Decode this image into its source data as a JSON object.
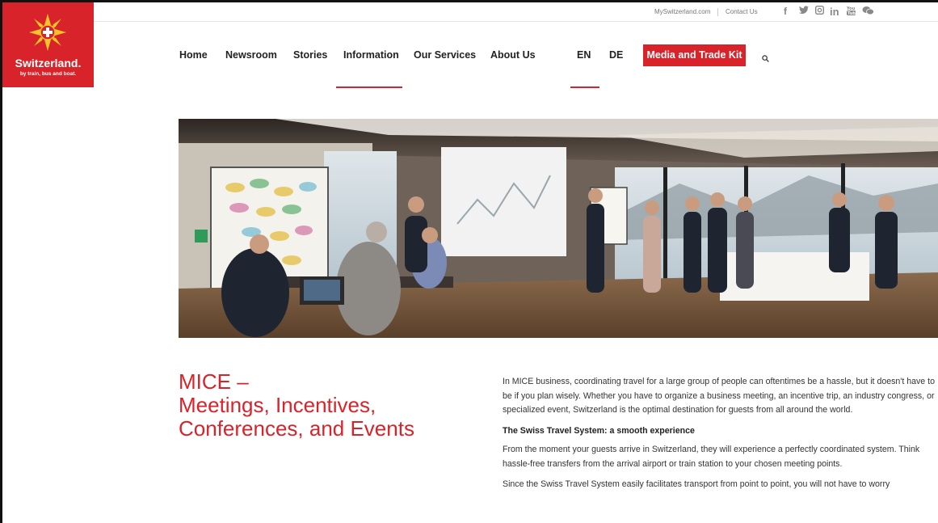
{
  "utility": {
    "myswitzerland": "MySwitzerland.com",
    "contact": "Contact Us"
  },
  "social_icons": [
    "facebook-icon",
    "twitter-icon",
    "instagram-icon",
    "linkedin-icon",
    "youtube-icon",
    "wechat-icon"
  ],
  "logo": {
    "title": "Switzerland.",
    "subtitle": "by train, bus and boat."
  },
  "nav": {
    "items": [
      "Home",
      "Newsroom",
      "Stories",
      "Information",
      "Our Services",
      "About Us"
    ],
    "active": "Information",
    "languages": [
      "EN",
      "DE"
    ],
    "active_language": "EN",
    "cta": "Media and Trade Kit"
  },
  "colors": {
    "brand_red": "#d8232a"
  },
  "main": {
    "heading_lines": [
      "MICE –",
      "Meetings, Incentives,",
      "Conferences, and Events"
    ],
    "intro": "In MICE business, coordinating travel for a large group of people can oftentimes be a hassle, but it doesn't have to be if you plan wisely. Whether you have to organize a business meeting, an incentive trip, an industry congress, or specialized event, Switzerland is the optimal destination for guests from all around the world.",
    "subheading": "The Swiss Travel System: a smooth experience",
    "para2": "From the moment your guests arrive in Switzerland, they will experience a perfectly coordinated system. Think hassle-free transfers from the arrival airport or train station to your chosen meeting points.",
    "para3": "Since the Swiss Travel System easily facilitates transport from point to point, you will not have to worry"
  }
}
